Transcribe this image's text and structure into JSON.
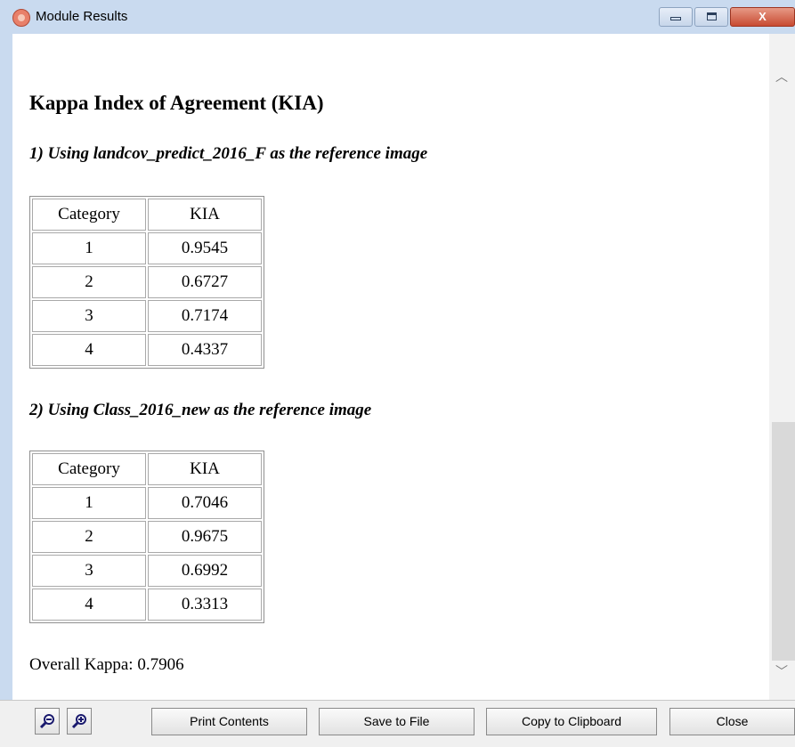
{
  "window": {
    "title": "Module Results",
    "controls": {
      "minimize": "–",
      "maximize": "□",
      "close": "X"
    }
  },
  "report": {
    "heading": "Kappa Index of Agreement (KIA)",
    "sections": [
      {
        "title": "1) Using landcov_predict_2016_F as the reference image",
        "table": {
          "headers": [
            "Category",
            "KIA"
          ],
          "rows": [
            [
              "1",
              "0.9545"
            ],
            [
              "2",
              "0.6727"
            ],
            [
              "3",
              "0.7174"
            ],
            [
              "4",
              "0.4337"
            ]
          ]
        }
      },
      {
        "title": "2) Using Class_2016_new as the reference image",
        "table": {
          "headers": [
            "Category",
            "KIA"
          ],
          "rows": [
            [
              "1",
              "0.7046"
            ],
            [
              "2",
              "0.9675"
            ],
            [
              "3",
              "0.6992"
            ],
            [
              "4",
              "0.3313"
            ]
          ]
        }
      }
    ],
    "overall": "Overall Kappa: 0.7906"
  },
  "toolbar": {
    "zoom_out_icon": "zoom-out-magnifier",
    "zoom_in_icon": "zoom-in-magnifier",
    "print_label": "Print Contents",
    "save_label": "Save to File",
    "copy_label": "Copy to Clipboard",
    "close_label": "Close"
  },
  "colors": {
    "titlebar": "#c9daef",
    "close_button": "#c84b32",
    "content_background": "#ffffff"
  }
}
